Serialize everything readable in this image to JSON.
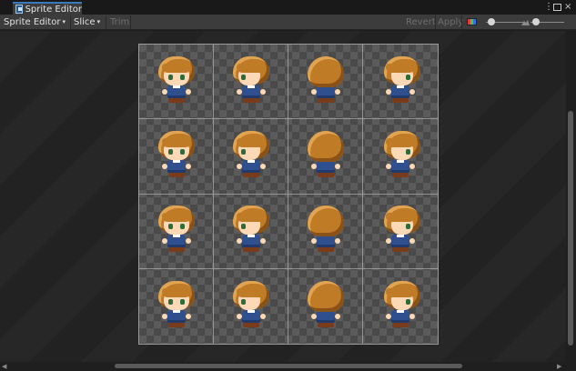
{
  "window": {
    "tab_title": "Sprite Editor",
    "menu_icon": "ellipsis-vertical-icon",
    "maximize_icon": "maximize-icon",
    "close_icon": "close-icon",
    "menu_glyph": "⋮",
    "close_glyph": "×"
  },
  "toolbar": {
    "mode_label": "Sprite Editor",
    "slice_label": "Slice",
    "trim_label": "Trim",
    "revert_label": "Revert",
    "apply_label": "Apply",
    "caret_glyph": "▾",
    "color_toggle_icon": "rgb-channel-icon",
    "slider_min_icon": "small-mountain-icon",
    "slider_max_icon": "large-mountain-icon"
  },
  "sprite_sheet": {
    "rows": 4,
    "columns": 4,
    "frames": [
      "front",
      "side-left",
      "back",
      "side-right",
      "front",
      "side-left",
      "back",
      "side-right",
      "front",
      "side-left",
      "back",
      "side-right",
      "front",
      "side-left",
      "back",
      "side-right"
    ],
    "colors": {
      "hair": "#c07b26",
      "skin": "#fbd9b6",
      "eyes": "#2e6b3a",
      "shirt": "#2f4f8f",
      "shoes": "#7a3b1a",
      "grid_line": "#c8c8c8"
    }
  },
  "colors": {
    "tab_accent": "#3a79bb",
    "toolbar_bg": "#3c3c3c",
    "canvas_bg": "#232323",
    "checker_light": "#5b5b5b",
    "checker_dark": "#4a4a4a"
  }
}
